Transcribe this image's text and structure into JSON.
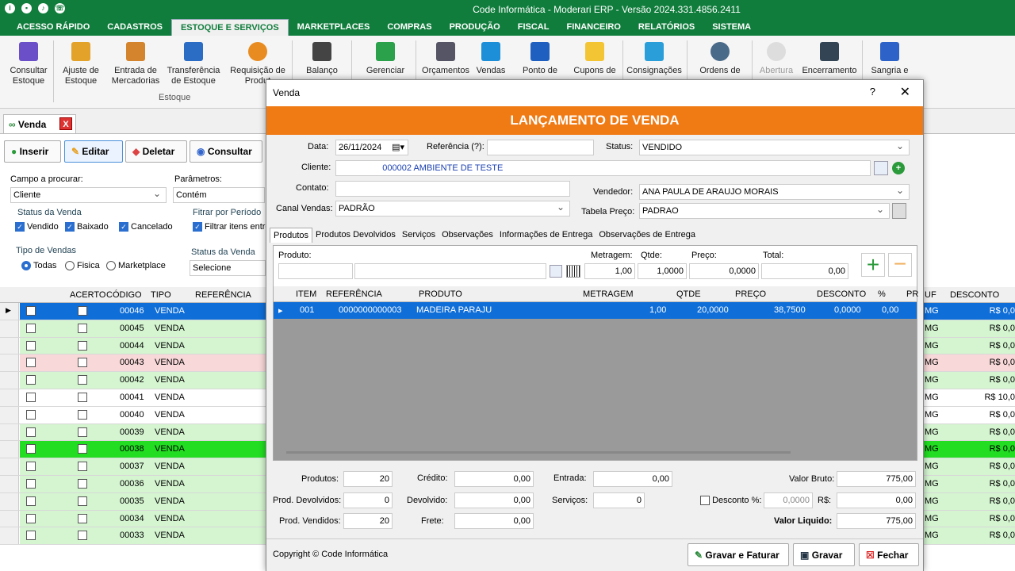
{
  "app": {
    "title": "Code Informática - Moderari ERP - Versão 2024.331.4856.2411"
  },
  "menu": [
    "ACESSO RÁPIDO",
    "CADASTROS",
    "ESTOQUE E SERVIÇOS",
    "MARKETPLACES",
    "COMPRAS",
    "PRODUÇÃO",
    "FISCAL",
    "FINANCEIRO",
    "RELATÓRIOS",
    "SISTEMA"
  ],
  "ribbon": {
    "group_label": "Estoque",
    "items": [
      {
        "l1": "Consultar",
        "l2": "Estoque"
      },
      {
        "l1": "Ajuste de",
        "l2": "Estoque"
      },
      {
        "l1": "Entrada de",
        "l2": "Mercadorias"
      },
      {
        "l1": "Transferência",
        "l2": "de Estoque"
      },
      {
        "l1": "Requisição de",
        "l2": "Produt"
      },
      {
        "l1": "Balanço",
        "l2": ""
      },
      {
        "l1": "Gerenciar",
        "l2": ""
      },
      {
        "l1": "Orçamentos",
        "l2": ""
      },
      {
        "l1": "Vendas",
        "l2": ""
      },
      {
        "l1": "Ponto de",
        "l2": ""
      },
      {
        "l1": "Cupons de",
        "l2": ""
      },
      {
        "l1": "Consignações",
        "l2": ""
      },
      {
        "l1": "Ordens de",
        "l2": ""
      },
      {
        "l1": "Abertura",
        "l2": ""
      },
      {
        "l1": "Encerramento",
        "l2": ""
      },
      {
        "l1": "Sangria e",
        "l2": ""
      }
    ]
  },
  "doctab": {
    "label": "Venda",
    "close": "X"
  },
  "toolbar": {
    "insert": "Inserir",
    "edit": "Editar",
    "delete": "Deletar",
    "search": "Consultar"
  },
  "filters": {
    "campo_label": "Campo a procurar:",
    "campo_value": "Cliente",
    "param_label": "Parâmetros:",
    "param_value": "Contém",
    "status_label": "Status da Venda",
    "vendido": "Vendido",
    "baixado": "Baixado",
    "cancelado": "Cancelado",
    "periodo_label": "Fitrar por Período",
    "periodo_cb": "Filtrar itens entre",
    "tipo_label": "Tipo de Vendas",
    "todas": "Todas",
    "fisica": "Fisica",
    "marketplace": "Marketplace",
    "status2_label": "Status da Venda",
    "status2_value": "Selecione"
  },
  "grid": {
    "headers": {
      "acerto": "ACERTO",
      "codigo": "CÓDIGO",
      "tipo": "TIPO",
      "referencia": "REFERÊNCIA",
      "uf": "UF",
      "desconto": "DESCONTO"
    },
    "rows": [
      {
        "code": "00046",
        "tipo": "VENDA",
        "uf": "MG",
        "desc": "R$ 0,0"
      },
      {
        "code": "00045",
        "tipo": "VENDA",
        "uf": "MG",
        "desc": "R$ 0,0"
      },
      {
        "code": "00044",
        "tipo": "VENDA",
        "uf": "MG",
        "desc": "R$ 0,0"
      },
      {
        "code": "00043",
        "tipo": "VENDA",
        "uf": "MG",
        "desc": "R$ 0,0"
      },
      {
        "code": "00042",
        "tipo": "VENDA",
        "uf": "MG",
        "desc": "R$ 0,0"
      },
      {
        "code": "00041",
        "tipo": "VENDA",
        "uf": "MG",
        "desc": "R$ 10,0"
      },
      {
        "code": "00040",
        "tipo": "VENDA",
        "uf": "MG",
        "desc": "R$ 0,0"
      },
      {
        "code": "00039",
        "tipo": "VENDA",
        "uf": "MG",
        "desc": "R$ 0,0"
      },
      {
        "code": "00038",
        "tipo": "VENDA",
        "uf": "MG",
        "desc": "R$ 0,0"
      },
      {
        "code": "00037",
        "tipo": "VENDA",
        "uf": "MG",
        "desc": "R$ 0,0"
      },
      {
        "code": "00036",
        "tipo": "VENDA",
        "uf": "MG",
        "desc": "R$ 0,0"
      },
      {
        "code": "00035",
        "tipo": "VENDA",
        "uf": "MG",
        "desc": "R$ 0,0"
      },
      {
        "code": "00034",
        "tipo": "VENDA",
        "uf": "MG",
        "desc": "R$ 0,0"
      },
      {
        "code": "00033",
        "tipo": "VENDA",
        "uf": "MG",
        "desc": "R$ 0,0"
      }
    ]
  },
  "modal": {
    "title": "Venda",
    "help": "?",
    "close": "✕",
    "header": "LANÇAMENTO DE VENDA",
    "data_label": "Data:",
    "data_value": "26/11/2024",
    "ref_label": "Referência (?):",
    "status_label": "Status:",
    "status_value": "VENDIDO",
    "cliente_label": "Cliente:",
    "cliente_code": "000002",
    "cliente_name": "AMBIENTE DE TESTE",
    "contato_label": "Contato:",
    "vendedor_label": "Vendedor:",
    "vendedor_value": "ANA PAULA DE ARAUJO MORAIS",
    "canal_label": "Canal Vendas:",
    "canal_value": "PADRÃO",
    "tabela_label": "Tabela Preço:",
    "tabela_value": "PADRAO",
    "tabs": [
      "Produtos",
      "Produtos Devolvidos",
      "Serviços",
      "Observações",
      "Informações de Entrega",
      "Observações de Entrega"
    ],
    "entry": {
      "produto": "Produto:",
      "metragem": "Metragem:",
      "qtde": "Qtde:",
      "preco": "Preço:",
      "total": "Total:",
      "metragem_v": "1,00",
      "qtde_v": "1,0000",
      "preco_v": "0,0000",
      "total_v": "0,00"
    },
    "items_hdr": {
      "item": "ITEM",
      "ref": "REFERÊNCIA",
      "produto": "PRODUTO",
      "metragem": "METRAGEM",
      "qtde": "QTDE",
      "preco": "PREÇO",
      "desconto": "DESCONTO",
      "pct": "%",
      "pr": "PR"
    },
    "item": {
      "item": "001",
      "ref": "0000000000003",
      "produto": "MADEIRA PARAJU",
      "metragem": "1,00",
      "qtde": "20,0000",
      "preco": "38,7500",
      "desconto": "0,0000",
      "pct": "0,00"
    },
    "totals": {
      "produtos_l": "Produtos:",
      "produtos_v": "20",
      "credito_l": "Crédito:",
      "credito_v": "0,00",
      "entrada_l": "Entrada:",
      "entrada_v": "0,00",
      "bruto_l": "Valor Bruto:",
      "bruto_v": "775,00",
      "devolvidos_l": "Prod. Devolvidos:",
      "devolvidos_v": "0",
      "devolvido_l": "Devolvido:",
      "devolvido_v": "0,00",
      "servicos_l": "Serviços:",
      "servicos_v": "0",
      "desconto_l": "Desconto %:",
      "desconto_pct": "0,0000",
      "rs_l": "R$:",
      "rs_v": "0,00",
      "vendidos_l": "Prod. Vendidos:",
      "vendidos_v": "20",
      "frete_l": "Frete:",
      "frete_v": "0,00",
      "liquido_l": "Valor Liquido:",
      "liquido_v": "775,00"
    },
    "footer": {
      "copyright": "Copyright © Code Informática",
      "faturar": "Gravar e Faturar",
      "gravar": "Gravar",
      "fechar": "Fechar"
    }
  }
}
